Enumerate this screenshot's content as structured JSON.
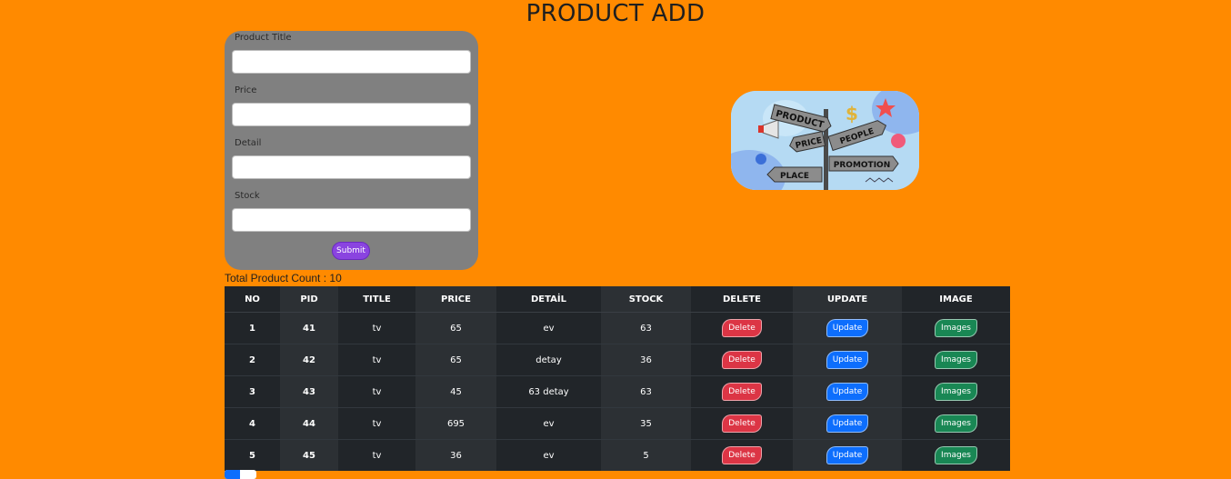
{
  "page": {
    "title": "PRODUCT ADD"
  },
  "form": {
    "fields": [
      {
        "label": "Product Title",
        "value": ""
      },
      {
        "label": "Price",
        "value": ""
      },
      {
        "label": "Detail",
        "value": ""
      },
      {
        "label": "Stock",
        "value": ""
      }
    ],
    "submit_label": "Submit",
    "card_color": "#808080",
    "submit_color": "#8a44e0"
  },
  "hero": {
    "signs": [
      "PRODUCT",
      "PRICE",
      "PEOPLE",
      "PROMOTION",
      "PLACE"
    ],
    "dollar": "$"
  },
  "summary": {
    "count_text": "Total Product Count : 10"
  },
  "table": {
    "headers": [
      "NO",
      "PID",
      "TITLE",
      "PRICE",
      "DETAİL",
      "STOCK",
      "DELETE",
      "UPDATE",
      "IMAGE"
    ],
    "rows": [
      {
        "no": "1",
        "pid": "41",
        "title": "tv",
        "price": "65",
        "detail": "ev",
        "stock": "63"
      },
      {
        "no": "2",
        "pid": "42",
        "title": "tv",
        "price": "65",
        "detail": "detay",
        "stock": "36"
      },
      {
        "no": "3",
        "pid": "43",
        "title": "tv",
        "price": "45",
        "detail": "63 detay",
        "stock": "63"
      },
      {
        "no": "4",
        "pid": "44",
        "title": "tv",
        "price": "695",
        "detail": "ev",
        "stock": "35"
      },
      {
        "no": "5",
        "pid": "45",
        "title": "tv",
        "price": "36",
        "detail": "ev",
        "stock": "5"
      }
    ],
    "delete_label": "Delete",
    "update_label": "Update",
    "images_label": "Images"
  },
  "colors": {
    "background": "#ff8a00",
    "table": "#212529",
    "delete": "#dc3545",
    "update": "#0d6efd",
    "images": "#198754"
  }
}
